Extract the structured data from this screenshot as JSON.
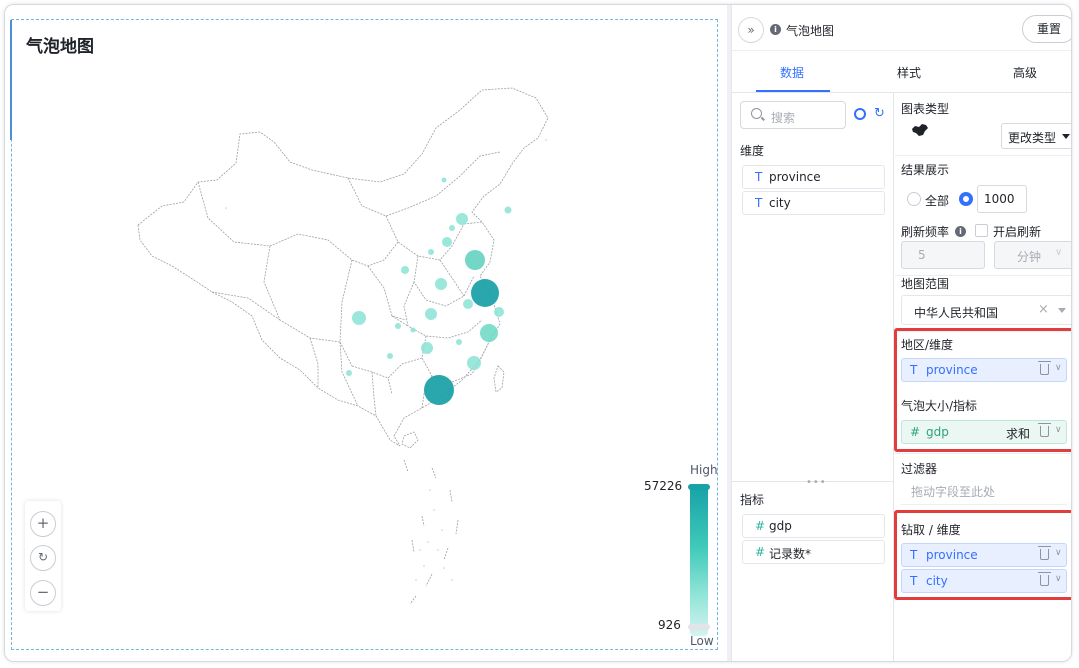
{
  "chart": {
    "title": "气泡地图",
    "legend": {
      "high_label": "High",
      "low_label": "Low",
      "max": "57226",
      "min": "926",
      "max_color": "#17a2a8",
      "min_color": "#d5f3f0"
    }
  },
  "controls": {
    "zoom_in": "+",
    "reset": "↻",
    "zoom_out": "−"
  },
  "panel": {
    "collapse_icon": "»",
    "title": "气泡地图",
    "reset_label": "重置",
    "tabs": [
      {
        "label": "数据"
      },
      {
        "label": "样式"
      },
      {
        "label": "高级"
      }
    ],
    "dataset": {
      "search_placeholder": "搜索",
      "dimension_label": "维度",
      "dimensions": [
        {
          "type": "T",
          "name": "province"
        },
        {
          "type": "T",
          "name": "city"
        }
      ],
      "measure_label": "指标",
      "measures": [
        {
          "type": "#",
          "name": "gdp"
        },
        {
          "type": "#",
          "name": "记录数*"
        }
      ]
    },
    "config": {
      "chart_type_label": "图表类型",
      "change_type_label": "更改类型",
      "result_label": "结果展示",
      "all_label": "全部",
      "result_limit": "1000",
      "refresh_label": "刷新频率",
      "enable_refresh_label": "开启刷新",
      "refresh_value": "5",
      "refresh_unit": "分钟",
      "map_range_label": "地图范围",
      "map_range_value": "中华人民共和国",
      "area_dim_label": "地区/维度",
      "area_dim_field": {
        "type": "T",
        "name": "province"
      },
      "bubble_size_label": "气泡大小/指标",
      "bubble_size_field": {
        "type": "#",
        "name": "gdp",
        "agg": "求和"
      },
      "filter_label": "过滤器",
      "filter_hint": "拖动字段至此处",
      "drill_label": "钻取 / 维度",
      "drill_fields": [
        {
          "type": "T",
          "name": "province"
        },
        {
          "type": "T",
          "name": "city"
        }
      ]
    }
  },
  "colors": {
    "accent": "#3370ff",
    "highlight": "#e03e3e",
    "bubble_dark": "#1ea2a8",
    "bubble_light": "#8ae3d5"
  }
}
